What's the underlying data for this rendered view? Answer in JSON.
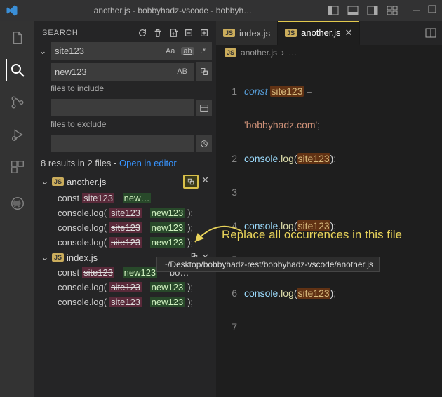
{
  "titlebar": {
    "title": "another.js - bobbyhadz-vscode - bobbyh…"
  },
  "search": {
    "header": "SEARCH",
    "query": "site123",
    "replace": "new123",
    "case_opt": "Aa",
    "word_opt": "ab",
    "regex_opt": ".*",
    "preserve_opt": "AB",
    "include_label": "files to include",
    "exclude_label": "files to exclude",
    "summary_text": "8 results in 2 files - ",
    "summary_link": "Open in editor"
  },
  "tree": {
    "file1": "another.js",
    "file2": "index.js",
    "r1_pre": "const ",
    "r1_old": "site123",
    "r1_new": "new…",
    "rlog_pre": "console.log(",
    "rlog_old": "site123",
    "rlog_new": "new123",
    "rlog_post": ");",
    "ridx_pre": "const ",
    "ridx_old": "site123",
    "ridx_new": "new123",
    "ridx_post": " = 'bo…"
  },
  "tabs": {
    "t1": "index.js",
    "t2": "another.js"
  },
  "breadcrumb": {
    "file": "another.js",
    "rest": "…"
  },
  "editor": {
    "l1a": "const ",
    "l1b": "site123",
    "l1c": " =",
    "l2": "'bobbyhadz.com'",
    "l2b": ";",
    "log_a": "console",
    "log_b": ".",
    "log_c": "log",
    "log_d": "(",
    "log_e": "site123",
    "log_f": ");",
    "ln1": "1",
    "ln2": "2",
    "ln3": "3",
    "ln4": "4",
    "ln5": "5",
    "ln6": "6",
    "ln7": "7"
  },
  "annotation": "Replace all occurrences in this file",
  "tooltip": "~/Desktop/bobbyhadz-rest/bobbyhadz-vscode/another.js"
}
